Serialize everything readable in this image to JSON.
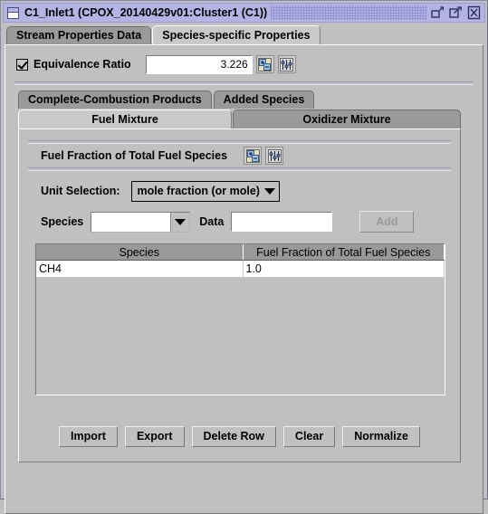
{
  "window": {
    "title": "C1_Inlet1  (CPOX_20140429v01:Cluster1 (C1))",
    "icon": "window-icon",
    "controls": [
      {
        "name": "minimize-button",
        "icon": "minimize-icon"
      },
      {
        "name": "maximize-button",
        "icon": "maximize-icon"
      },
      {
        "name": "close-button",
        "icon": "close-icon"
      }
    ]
  },
  "outer_tabs": [
    {
      "label": "Stream Properties Data",
      "active": false
    },
    {
      "label": "Species-specific Properties",
      "active": true
    }
  ],
  "equivalence": {
    "checkbox_checked": true,
    "label": "Equivalence Ratio",
    "value": "3.226",
    "icons": [
      {
        "name": "plus-minus-icon"
      },
      {
        "name": "sliders-icon"
      }
    ]
  },
  "inner_tabs_row1": [
    {
      "label": "Complete-Combustion Products",
      "active": false
    },
    {
      "label": "Added Species",
      "active": false
    }
  ],
  "inner_tabs_row2": [
    {
      "label": "Fuel Mixture",
      "active": true
    },
    {
      "label": "Oxidizer Mixture",
      "active": false
    }
  ],
  "mixture": {
    "fuel_fraction_label": "Fuel Fraction of Total Fuel Species",
    "fuel_fraction_icons": [
      {
        "name": "plus-minus-icon"
      },
      {
        "name": "sliders-icon"
      }
    ],
    "unit_selection_label": "Unit Selection:",
    "unit_selection_value": "mole fraction (or mole)",
    "species_label": "Species",
    "species_value": "",
    "species_placeholder": "",
    "data_label": "Data",
    "data_value": "",
    "data_placeholder": "",
    "add_label": "Add",
    "add_enabled": false
  },
  "table": {
    "columns": [
      "Species",
      "Fuel Fraction of Total Fuel Species"
    ],
    "rows": [
      [
        "CH4",
        "1.0"
      ]
    ]
  },
  "buttons": [
    {
      "label": "Import",
      "name": "import-button"
    },
    {
      "label": "Export",
      "name": "export-button"
    },
    {
      "label": "Delete Row",
      "name": "delete-row-button"
    },
    {
      "label": "Clear",
      "name": "clear-button"
    },
    {
      "label": "Normalize",
      "name": "normalize-button"
    }
  ],
  "colors": {
    "titlebar": "#b4b4e4",
    "panel": "#c0c0c0",
    "tab_inactive": "#9a9a9a",
    "tab_active": "#c9c9c9",
    "table_header": "#999999",
    "field_background": "#ffffff"
  }
}
